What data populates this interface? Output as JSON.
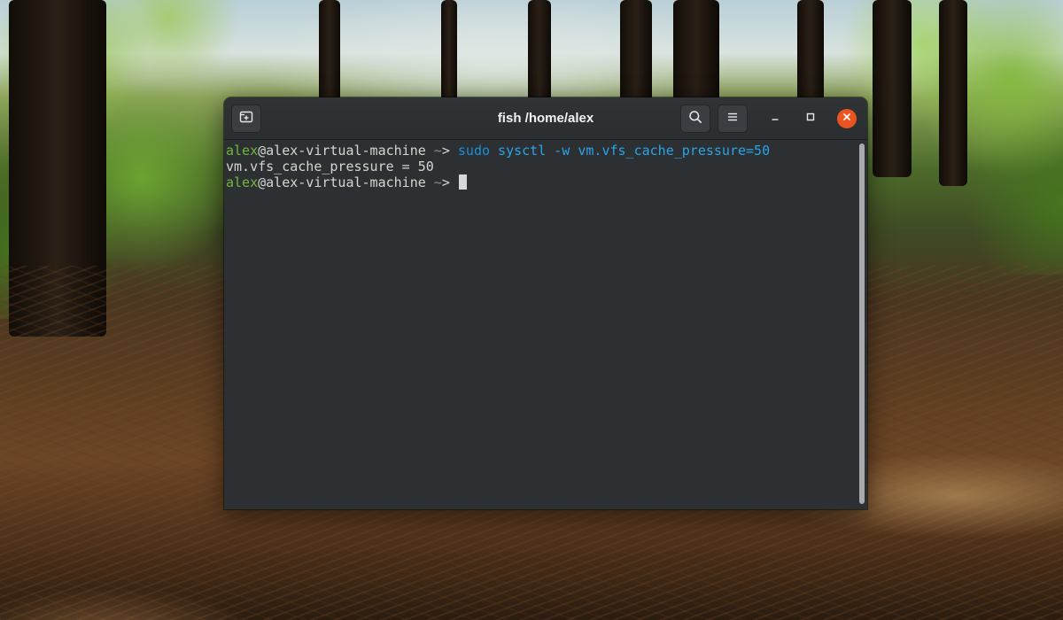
{
  "window": {
    "title": "fish /home/alex"
  },
  "headerbar": {
    "new_tab_icon": "new-tab-icon",
    "search_icon": "search-icon",
    "menu_icon": "hamburger-menu-icon",
    "minimize_icon": "minimize-icon",
    "maximize_icon": "maximize-icon",
    "close_icon": "close-icon"
  },
  "terminal": {
    "lines": [
      {
        "user": "alex",
        "host": "@alex-virtual-machine",
        "path": " ~",
        "prompt": "> ",
        "cmd": "sudo",
        "args": " sysctl -w vm.vfs_cache_pressure=50"
      },
      {
        "output": "vm.vfs_cache_pressure = 50"
      },
      {
        "user": "alex",
        "host": "@alex-virtual-machine",
        "path": " ~",
        "prompt": "> "
      }
    ]
  },
  "colors": {
    "close_button": "#e95420",
    "terminal_bg": "#2d3033",
    "prompt_user": "#6fb83a",
    "command": "#1a8fdc"
  }
}
